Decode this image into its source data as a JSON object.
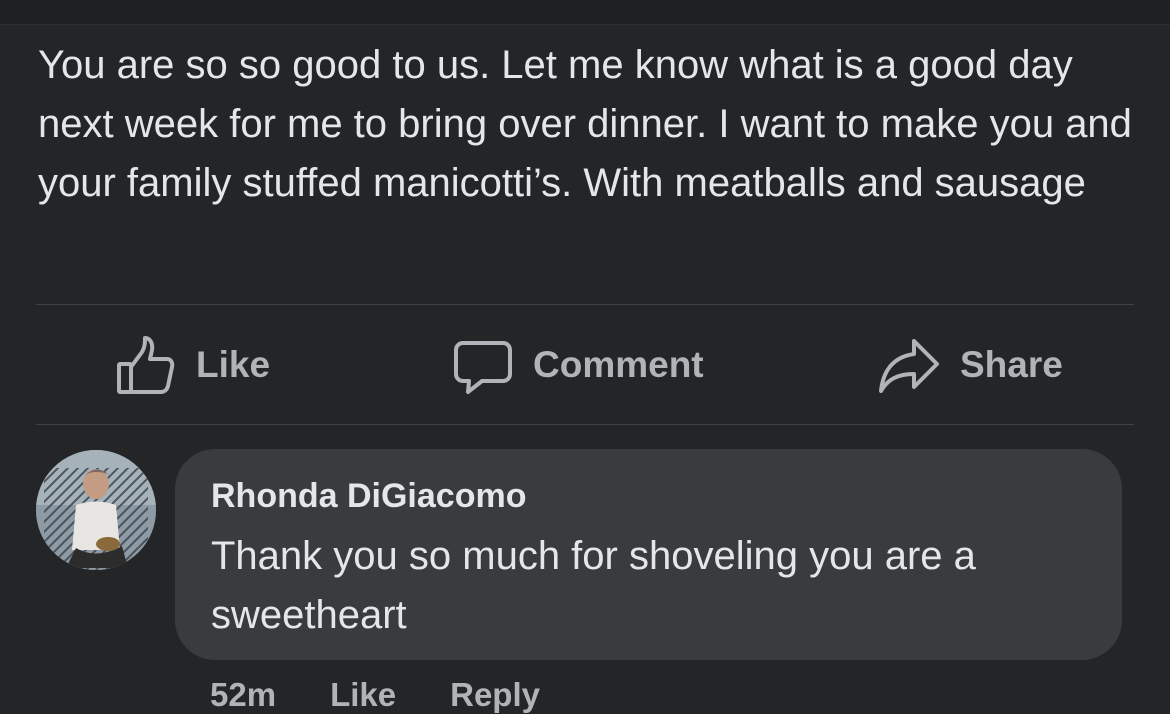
{
  "post": {
    "text": "You are so so good to us. Let me know what is a good day next week for me to bring over dinner. I want to make you and your family stuffed manicotti’s. With meatballs and sausage"
  },
  "actions": {
    "like": "Like",
    "comment": "Comment",
    "share": "Share"
  },
  "comment": {
    "author": "Rhonda DiGiacomo",
    "text": "Thank you so much for shoveling you are a sweetheart",
    "time": "52m",
    "like": "Like",
    "reply": "Reply"
  },
  "colors": {
    "background": "#242526",
    "bubble": "#3a3b3c",
    "text": "#e4e6eb",
    "secondary": "#b0b3b8"
  }
}
